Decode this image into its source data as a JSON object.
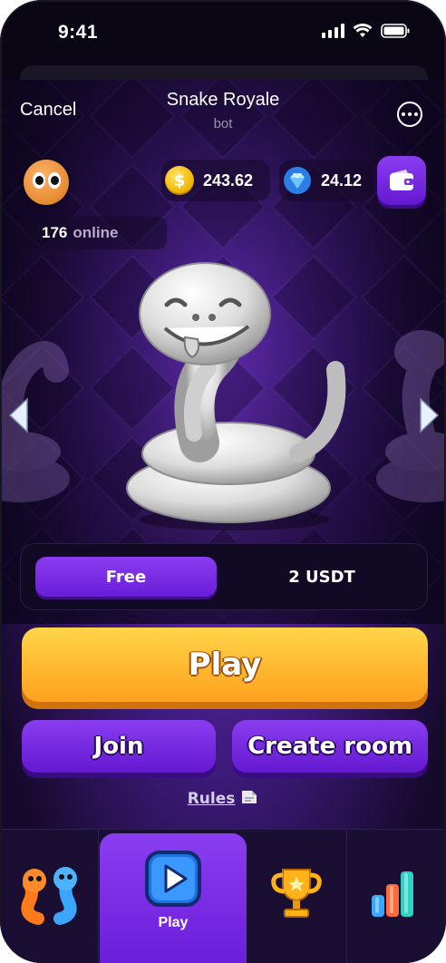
{
  "status_bar": {
    "time": "9:41"
  },
  "header": {
    "cancel_label": "Cancel",
    "title": "Snake Royale",
    "subtitle": "bot"
  },
  "balances": [
    {
      "icon": "gold-coin-icon",
      "value": "243.62",
      "color": "#f3b400"
    },
    {
      "icon": "diamond-icon",
      "value": "24.12",
      "color": "#3aa0ff"
    }
  ],
  "online": {
    "count": "176",
    "label": "online"
  },
  "price_toggle": {
    "options": [
      {
        "label": "Free",
        "selected": true
      },
      {
        "label": "2 USDT",
        "selected": false
      }
    ]
  },
  "actions": {
    "play_label": "Play",
    "join_label": "Join",
    "create_room_label": "Create room",
    "rules_label": "Rules"
  },
  "bottom_nav": {
    "items": [
      {
        "name": "snakes",
        "icon": "snakes-characters-icon",
        "label": "",
        "active": false
      },
      {
        "name": "play",
        "icon": "play-icon",
        "label": "Play",
        "active": true
      },
      {
        "name": "leaderboard",
        "icon": "trophy-icon",
        "label": "",
        "active": false
      },
      {
        "name": "stats",
        "icon": "bar-chart-icon",
        "label": "",
        "active": false
      }
    ]
  },
  "colors": {
    "accent_purple": "#7a2fe6",
    "play_yellow": "#ffb62e",
    "background": "#3d1a7a"
  }
}
